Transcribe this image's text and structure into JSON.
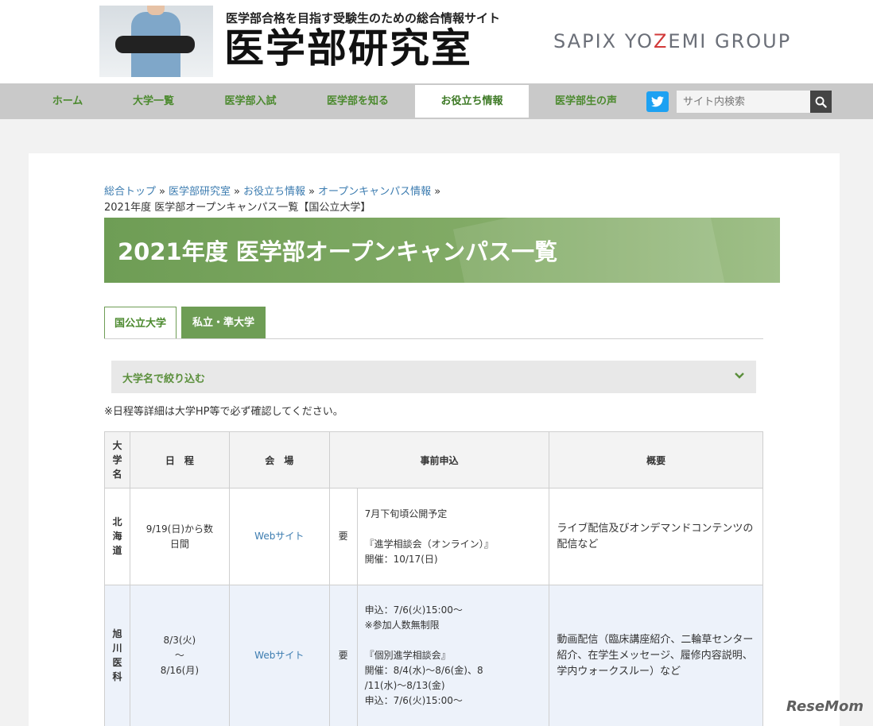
{
  "header": {
    "tagline": "医学部合格を目指す受験生のための総合情報サイト",
    "site_name": "医学部研究室",
    "group_logo_pre": "SAPIX YO",
    "group_logo_z": "Z",
    "group_logo_post": "EMI GROUP"
  },
  "nav": {
    "items": [
      "ホーム",
      "大学一覧",
      "医学部入試",
      "医学部を知る",
      "お役立ち情報",
      "医学部生の声"
    ],
    "active_index": 4,
    "search_placeholder": "サイト内検索"
  },
  "breadcrumb": {
    "links": [
      "総合トップ",
      "医学部研究室",
      "お役立ち情報",
      "オープンキャンパス情報"
    ],
    "separator": "»",
    "current": "2021年度 医学部オープンキャンパス一覧【国公立大学】"
  },
  "page_title": "2021年度 医学部オープンキャンパス一覧",
  "tabs": [
    "国公立大学",
    "私立・準大学"
  ],
  "filter_label": "大学名で絞り込む",
  "note": "※日程等詳細は大学HP等で必ず確認してください。",
  "table": {
    "headers": [
      "大学名",
      "日　程",
      "会　場",
      "事前申込",
      "概要"
    ],
    "rows": [
      {
        "university": "北海道",
        "schedule": "9/19(日)から数\n日間",
        "venue": "Webサイト",
        "required": "要",
        "application": "7月下旬頃公開予定\n\n『進学相談会（オンライン）』\n開催：10/17(日)",
        "overview": "ライブ配信及びオンデマンドコンテンツの配信など"
      },
      {
        "university": "旭川医科",
        "schedule": "8/3(火)\n～\n8/16(月)",
        "venue": "Webサイト",
        "required": "要",
        "application": "申込：7/6(火)15:00～\n※参加人数無制限\n\n『個別進学相談会』\n開催：8/4(水)～8/6(金)、8\n/11(水)～8/13(金)\n申込：7/6(火)15:00～",
        "overview": "動画配信（臨床講座紹介、二輪草センター紹介、在学生メッセージ、履修内容説明、学内ウォークスルー）など"
      }
    ]
  },
  "watermark": "ReseMom",
  "colors": {
    "brand_green": "#6e9d55",
    "nav_text": "#4c8a2f",
    "link_blue": "#3c7cb0",
    "twitter_blue": "#1da1f2"
  },
  "icons": [
    "twitter-icon",
    "search-icon",
    "chevron-down-icon"
  ]
}
